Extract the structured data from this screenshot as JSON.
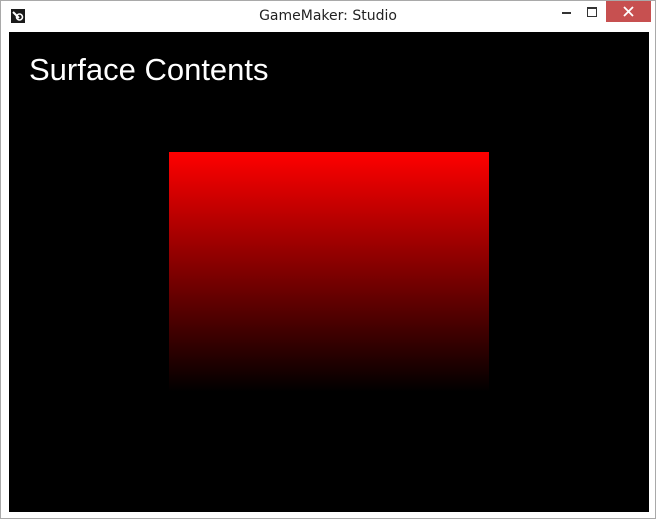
{
  "window": {
    "title": "GameMaker: Studio",
    "app_icon": "gamemaker-logo-icon",
    "controls": {
      "minimize_icon": "minimize-icon",
      "maximize_icon": "maximize-icon",
      "close_icon": "close-icon"
    },
    "close_hover_color": "#c75050"
  },
  "game": {
    "background_color": "#000000",
    "heading": "Surface Contents",
    "heading_color": "#ffffff",
    "surface": {
      "gradient_top_color": "#ff0000",
      "gradient_bottom_color": "#000000"
    }
  }
}
